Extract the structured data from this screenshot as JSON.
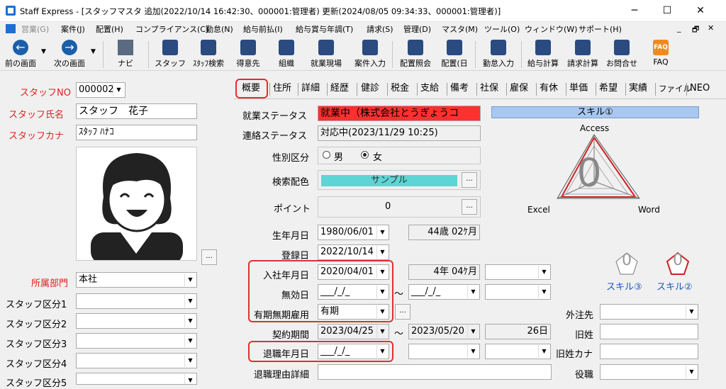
{
  "window": {
    "title": "Staff Express - [スタッフマスタ  追加(2022/10/14 16:42:30、000001:管理者)  更新(2024/08/05 09:34:33、000001:管理者)]",
    "min": "─",
    "max": "☐",
    "close": "✕"
  },
  "menu": [
    "営業(G)",
    "案件(J)",
    "配置(H)",
    "コンプライアンス(C)",
    "勤怠(N)",
    "給与前払(I)",
    "給与賞与年調(T)",
    "請求(S)",
    "管理(D)",
    "マスタ(M)",
    "ツール(O)",
    "ウィンドウ(W)",
    "サポート(H)"
  ],
  "toolbar": [
    "前の画面",
    "次の画面",
    "ナビ",
    "スタッフ",
    "ｽﾀｯﾌ検索",
    "得意先",
    "組織",
    "就業現場",
    "案件入力",
    "配置照会",
    "配置(日",
    "勤怠入力",
    "給与計算",
    "請求計算",
    "お問合せ",
    "FAQ"
  ],
  "left": {
    "staff_no_label": "スタッフNO",
    "staff_no": "000002",
    "name_label": "スタッフ氏名",
    "name": "スタッフ　花子",
    "kana_label": "スタッフカナ",
    "kana": "ｽﾀｯﾌ ﾊﾅｺ",
    "photo_btn": "...",
    "dept_label": "所属部門",
    "dept": "本社",
    "class1": "スタッフ区分1",
    "class2": "スタッフ区分2",
    "class3": "スタッフ区分3",
    "class4": "スタッフ区分4",
    "class5": "スタッフ区分5"
  },
  "tabs": [
    "概要",
    "住所",
    "詳細",
    "経歴",
    "健診",
    "税金",
    "支給",
    "備考",
    "社保",
    "雇保",
    "有休",
    "単価",
    "希望",
    "実績",
    "ファイル",
    "NEO"
  ],
  "overview": {
    "work_status_label": "就業ステータス",
    "work_status": "就業中（株式会社とうぎょうコ",
    "contact_status_label": "連絡ステータス",
    "contact_status": "対応中(2023/11/29 10:25)",
    "gender_label": "性別区分",
    "male": "男",
    "female": "女",
    "search_color_label": "検索配色",
    "search_color": "サンプル",
    "search_color_bg": "#5dd5d5",
    "point_label": "ポイント",
    "point": "0",
    "birth_label": "生年月日",
    "birth": "1980/06/01",
    "age": "44歳 02ｹ月",
    "reg_label": "登録日",
    "reg": "2022/10/14",
    "join_label": "入社年月日",
    "join": "2020/04/01",
    "tenure": "4年 04ｹ月",
    "invalid_label": "無効日",
    "invalid": "___/_/_",
    "employ_label": "有期無期雇用",
    "employ": "有期",
    "contract_label": "契約期間",
    "contract_from": "2023/04/25",
    "contract_to": "2023/05/20",
    "contract_days": "26日",
    "retire_label": "退職年月日",
    "retire": "___/_/_",
    "retire_reason_label": "退職理由詳細",
    "tilde": "～",
    "dots": "..."
  },
  "skill": {
    "header": "スキル①",
    "access": "Access",
    "excel": "Excel",
    "word": "Word",
    "value": "0",
    "small3": "スキル③",
    "small2": "スキル②",
    "small_val": "0"
  },
  "right": {
    "outsource_label": "外注先",
    "old_name_label": "旧姓",
    "old_kana_label": "旧姓カナ",
    "position_label": "役職"
  }
}
